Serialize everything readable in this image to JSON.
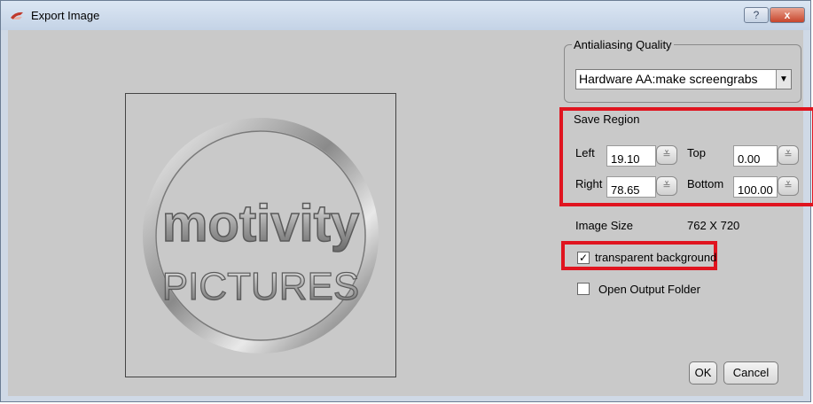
{
  "window": {
    "title": "Export Image",
    "help_label": "?",
    "close_label": "x"
  },
  "preview": {
    "logo_text_top": "motivity",
    "logo_text_bottom": "PICTURES"
  },
  "antialiasing": {
    "label": "Antialiasing Quality",
    "selected": "Hardware AA:make screengrabs"
  },
  "save_region": {
    "label": "Save Region",
    "left_label": "Left",
    "left_value": "19.10",
    "top_label": "Top",
    "top_value": "0.00",
    "right_label": "Right",
    "right_value": "78.65",
    "bottom_label": "Bottom",
    "bottom_value": "100.00"
  },
  "image_size": {
    "label": "Image Size",
    "value": "762 X 720"
  },
  "options": {
    "transparent_label": "transparent background",
    "transparent_checked": true,
    "open_folder_label": "Open Output Folder",
    "open_folder_checked": false
  },
  "buttons": {
    "ok": "OK",
    "cancel": "Cancel"
  },
  "colors": {
    "highlight": "#e0141f",
    "dialog_bg": "#c9c9c9",
    "titlebar": "#cfd9e6"
  },
  "icons": {
    "app": "export-image-icon",
    "spinner": "double-chevron-down-icon"
  }
}
